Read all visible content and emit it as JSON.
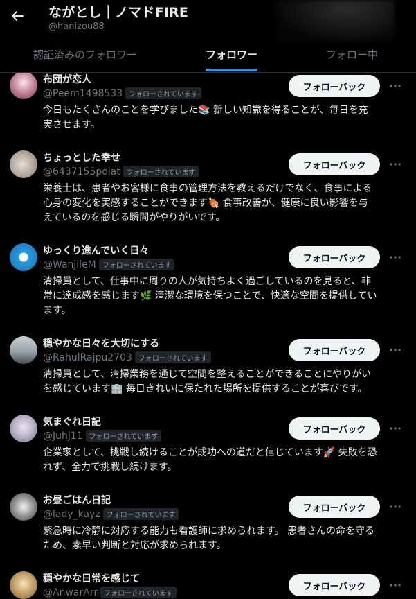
{
  "header": {
    "title": "ながとし｜ノマドFIRE",
    "handle": "@hanizou88"
  },
  "tabs": [
    {
      "label": "認証済みのフォロワー"
    },
    {
      "label": "フォロワー"
    },
    {
      "label": "フォロー中"
    }
  ],
  "followers": [
    {
      "name": "布団が恋人",
      "handle": "@Peem1498533",
      "badge": "フォローされています",
      "button": "フォローバック",
      "bio": [
        "今日もたくさんのことを学びました📚 新しい知識を得ることが、毎日を充",
        "実させます。"
      ]
    },
    {
      "name": "ちょっとした幸せ",
      "handle": "@6437155polat",
      "badge": "フォローされています",
      "button": "フォローバック",
      "bio": [
        "栄養士は、患者やお客様に食事の管理方法を教えるだけでなく、食事による",
        "心身の変化を実感することができます🍖 食事改善が、健康に良い影響を与",
        "えているのを感じる瞬間がやりがいです。"
      ]
    },
    {
      "name": "ゆっくり進んでいく日々",
      "handle": "@WanjileM",
      "badge": "フォローされています",
      "button": "フォローバック",
      "bio": [
        "清掃員として、仕事中に周りの人が気持ちよく過ごしているのを見ると、非",
        "常に達成感を感じます🌿 清潔な環境を保つことで、快適な空間を提供してい",
        "ます。"
      ]
    },
    {
      "name": "穏やかな日々を大切にする",
      "handle": "@RahulRajpu2703",
      "badge": "フォローされています",
      "button": "フォローバック",
      "bio": [
        "清掃員として、清掃業務を通じて空間を整えることができることにやりがい",
        "を感じています🏢 毎日きれいに保たれた場所を提供することが喜びです。"
      ]
    },
    {
      "name": "気まぐれ日記",
      "handle": "@Juhj11",
      "badge": "フォローされています",
      "button": "フォローバック",
      "bio": [
        "企業家として、挑戦し続けることが成功への道だと信じています🚀 失敗を恐",
        "れず、全力で挑戦し続けます。"
      ]
    },
    {
      "name": "お昼ごはん日記",
      "handle": "@lady_kayz",
      "badge": "フォローされています",
      "button": "フォローバック",
      "bio": [
        "緊急時に冷静に対応する能力も看護師に求められます。 患者さんの命を守る",
        "ため、素早い判断と対応が求められます。"
      ]
    },
    {
      "name": "穏やかな日常を感じて",
      "handle": "@AnwarArr",
      "badge": "フォローされています",
      "button": "フォローバック",
      "bio": []
    }
  ]
}
